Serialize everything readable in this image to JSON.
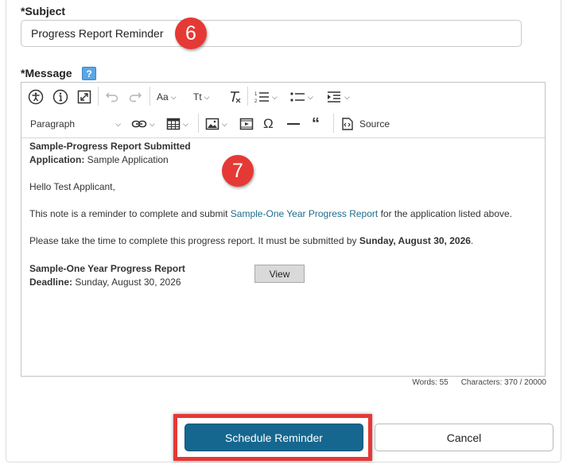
{
  "subject": {
    "label": "*Subject",
    "value": "Progress Report Reminder",
    "step_badge": "6"
  },
  "message": {
    "label": "*Message",
    "help_icon": "?",
    "step_badge": "7"
  },
  "toolbar": {
    "row1": [
      {
        "icon": "accessibility-icon"
      },
      {
        "icon": "info-icon"
      },
      {
        "icon": "fullscreen-icon"
      },
      {
        "icon": "undo-icon"
      },
      {
        "icon": "redo-icon"
      },
      {
        "icon": "font-family-icon",
        "text": "Aa"
      },
      {
        "icon": "font-size-icon",
        "text": "Tt"
      },
      {
        "icon": "clear-format-icon"
      },
      {
        "icon": "numbered-list-icon"
      },
      {
        "icon": "bulleted-list-icon"
      },
      {
        "icon": "indent-icon"
      }
    ],
    "paragraph_select": "Paragraph",
    "source_label": "Source"
  },
  "body": {
    "heading": "Sample-Progress Report Submitted",
    "application_label": "Application:",
    "application_value": " Sample Application",
    "greeting": "Hello Test Applicant,",
    "reminder_prefix": "This note is a reminder to complete and submit ",
    "reminder_link": "Sample-One Year Progress Report",
    "reminder_suffix": " for the application listed above.",
    "deadline_sentence_prefix": "Please take the time to complete this progress report. It must be submitted by ",
    "deadline_sentence_date": "Sunday, August 30, 2026",
    "deadline_sentence_suffix": ".",
    "report_title": "Sample-One Year Progress Report",
    "deadline_label": "Deadline:",
    "deadline_value": " Sunday, August 30, 2026",
    "view_button": "View"
  },
  "counts": {
    "words": "Words: 55",
    "characters": "Characters: 370 / 20000"
  },
  "actions": {
    "schedule": "Schedule Reminder",
    "cancel": "Cancel"
  },
  "colors": {
    "primary": "#15678f",
    "badge": "#e53935",
    "link": "#1f6d8c"
  }
}
